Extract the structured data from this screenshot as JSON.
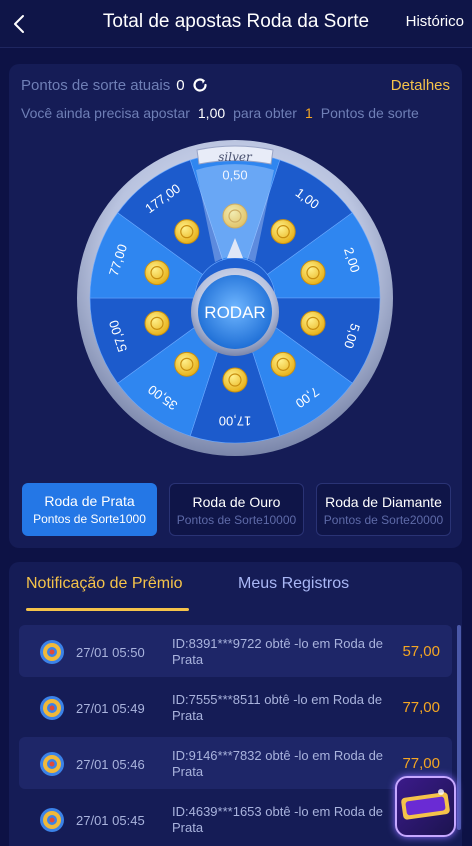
{
  "header": {
    "title": "Total de apostas Roda da Sorte",
    "history_label": "Histórico"
  },
  "points": {
    "label": "Pontos de sorte atuais",
    "value": "0",
    "details_label": "Detalhes",
    "need_prefix": "Você ainda precisa apostar",
    "need_amount": "1,00",
    "need_middle": "para obter",
    "need_points": "1",
    "need_suffix": "Pontos de sorte"
  },
  "wheel": {
    "banner": "silver",
    "spin_label": "RODAR",
    "segments": [
      "0,50",
      "1,00",
      "2,00",
      "5,00",
      "7,00",
      "17,00",
      "35,00",
      "57,00",
      "77,00",
      "177,00"
    ]
  },
  "wheel_tabs": [
    {
      "title": "Roda de Prata",
      "sub": "Pontos de Sorte1000"
    },
    {
      "title": "Roda de Ouro",
      "sub": "Pontos de Sorte10000"
    },
    {
      "title": "Roda de Diamante",
      "sub": "Pontos de Sorte20000"
    }
  ],
  "list_tabs": {
    "notif": "Notificação de Prêmio",
    "records": "Meus Registros"
  },
  "rows": [
    {
      "time": "27/01 05:50",
      "msg": "ID:8391***9722 obtê -lo em Roda de Prata",
      "amount": "57,00"
    },
    {
      "time": "27/01 05:49",
      "msg": "ID:7555***8511 obtê -lo em Roda de Prata",
      "amount": "77,00"
    },
    {
      "time": "27/01 05:46",
      "msg": "ID:9146***7832 obtê -lo em Roda de Prata",
      "amount": "77,00"
    },
    {
      "time": "27/01 05:45",
      "msg": "ID:4639***1653 obtê -lo em Roda de Prata",
      "amount": ""
    }
  ],
  "colors": {
    "background": "#0d1245",
    "card": "#151c56",
    "accent_gold": "#f5c34a",
    "accent_orange": "#f5a623",
    "active_blue": "#2477e6"
  }
}
